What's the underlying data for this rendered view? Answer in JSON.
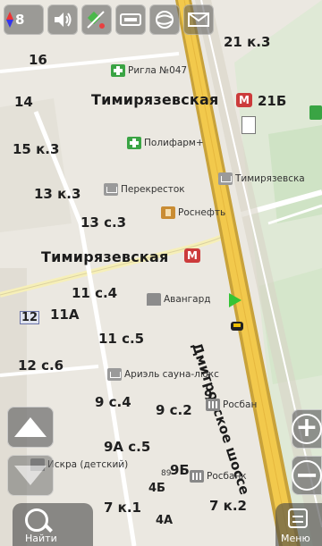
{
  "toolbar": {
    "compass_value": "8",
    "icons": [
      "compass-icon",
      "volume-icon",
      "gps-signal-icon",
      "traffic-icon",
      "route-icon",
      "message-icon"
    ]
  },
  "map": {
    "house_numbers": [
      "21 к.3",
      "16",
      "14",
      "21Б",
      "15 к.3",
      "13 к.3",
      "13 с.3",
      "11 с.4",
      "12",
      "11А",
      "11 с.5",
      "12 с.6",
      "9 с.4",
      "9 с.2",
      "9",
      "9А с.5",
      "9Б",
      "4Б",
      "7 к.1",
      "7 к.2",
      "4А"
    ],
    "streets": {
      "timiryazevskaya_top": "Тимирязевская",
      "timiryazevskaya_mid": "Тимирязевская",
      "dmitrovskoe": "Дмитровское шоссе"
    },
    "pois": {
      "rigla": "Ригла №047",
      "polifarm": "Полифарм+",
      "perekrestok": "Перекресток",
      "timiryazevskaya_poi": "Тимирязевска",
      "rosneft": "Роснефть",
      "avangard": "Авангард",
      "arizel": "Ариэль сауна-люкс",
      "rosbank1": "Росбан",
      "iskra": "Искра (детский)",
      "rosbank2": "Росбанк",
      "num89": "89"
    }
  },
  "controls": {
    "find_label": "Найти",
    "menu_label": "Меню",
    "zoom_in": "+",
    "zoom_out": "−"
  },
  "colors": {
    "road_yellow": "#f2c94c",
    "road_edge": "#c8a23a",
    "park_green": "#cfe3c5",
    "background": "#ebe8e1"
  }
}
